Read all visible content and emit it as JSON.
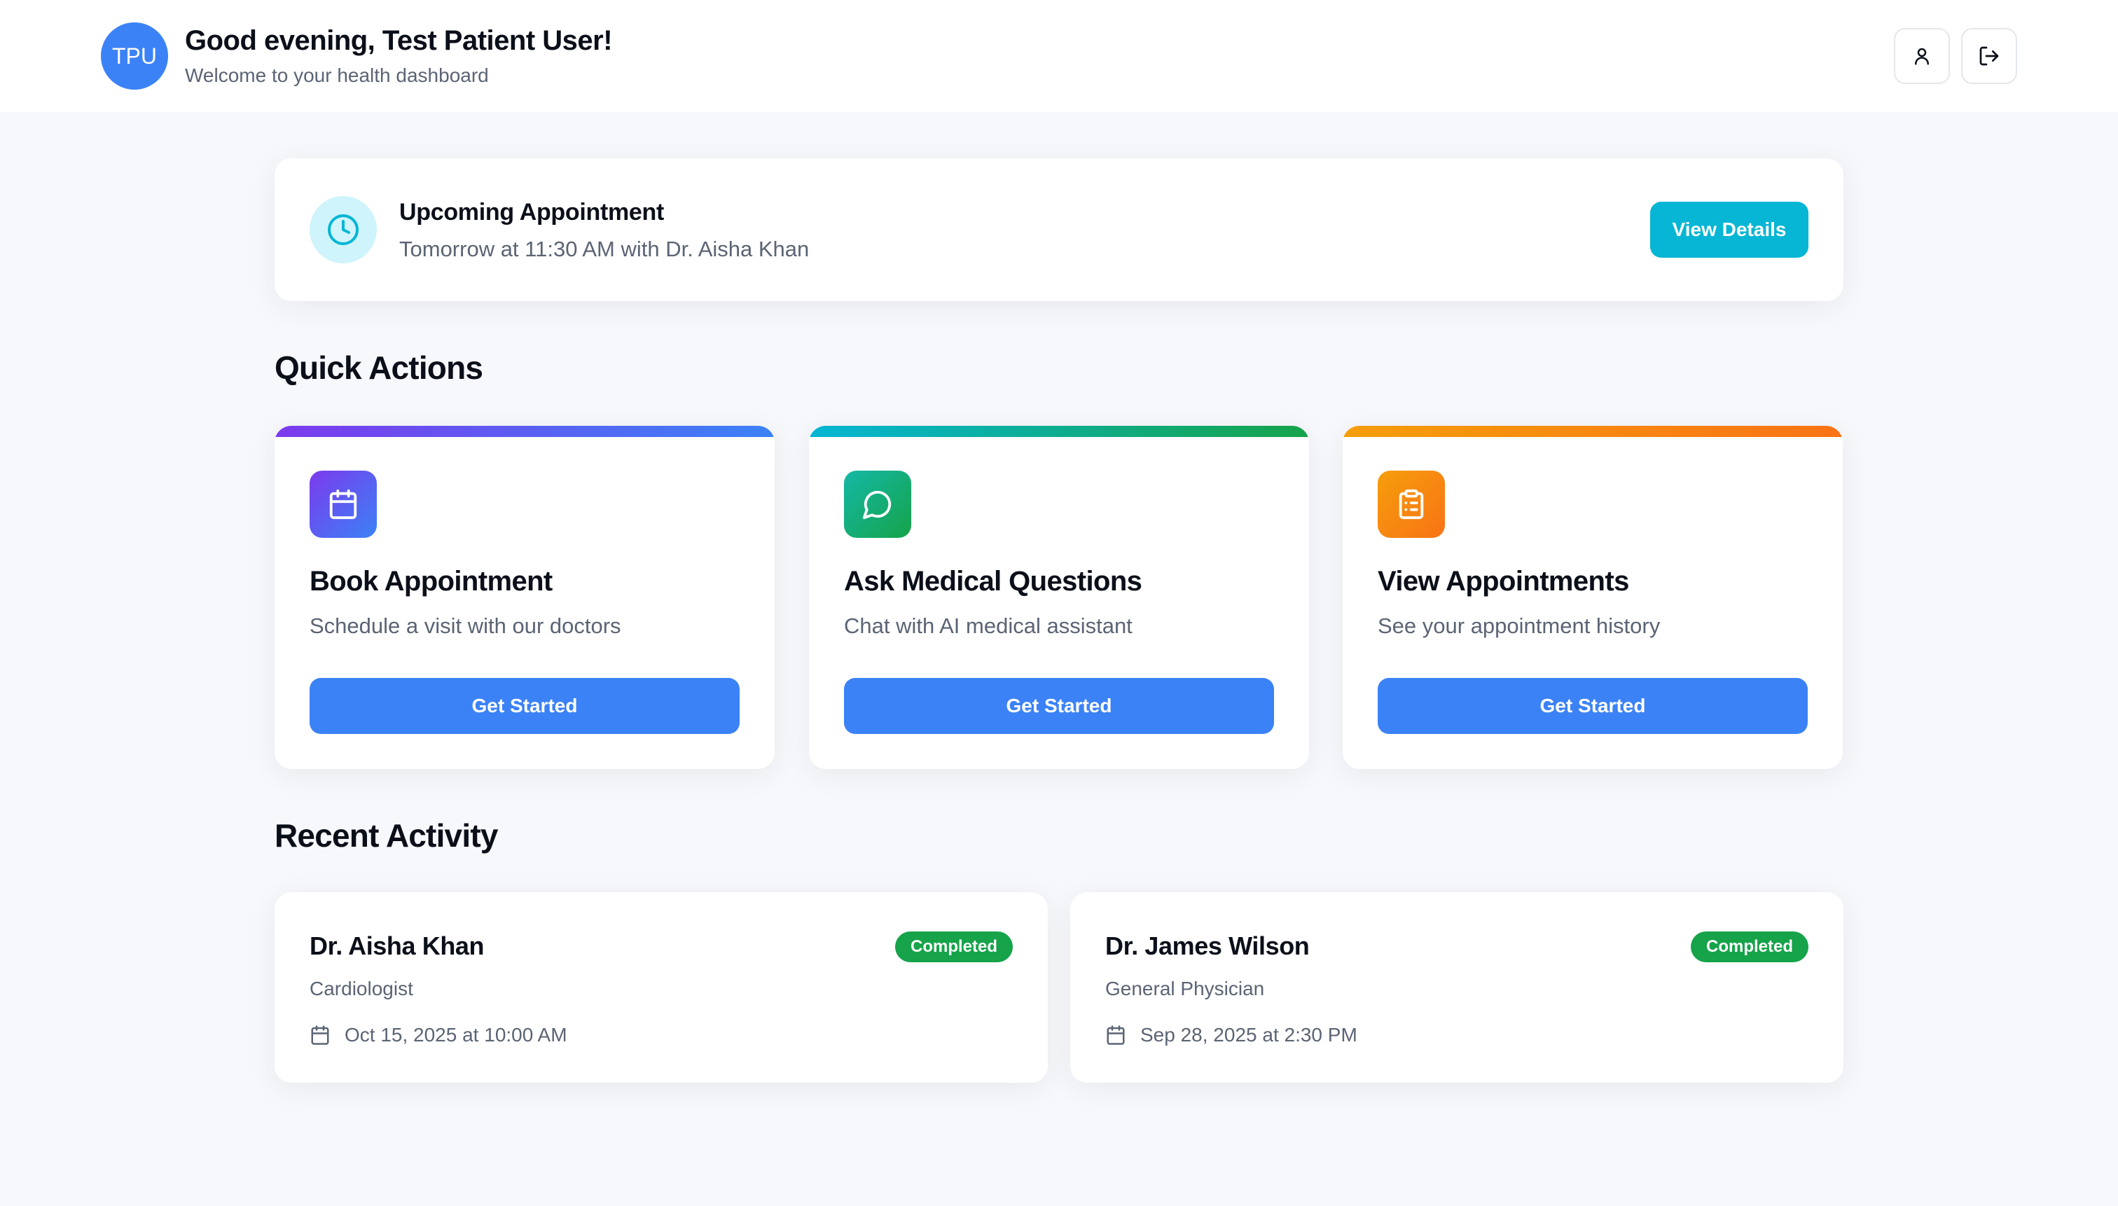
{
  "header": {
    "avatar_initials": "TPU",
    "greeting": "Good evening, Test Patient User!",
    "subtitle": "Welcome to your health dashboard",
    "profile_icon": "user-icon",
    "logout_icon": "logout-icon"
  },
  "upcoming": {
    "icon": "clock-icon",
    "title": "Upcoming Appointment",
    "detail": "Tomorrow at 11:30 AM with Dr. Aisha Khan",
    "button_label": "View Details"
  },
  "quick_actions": {
    "title": "Quick Actions",
    "cards": [
      {
        "icon": "calendar-icon",
        "title": "Book Appointment",
        "description": "Schedule a visit with our doctors",
        "button_label": "Get Started"
      },
      {
        "icon": "chat-bubble-icon",
        "title": "Ask Medical Questions",
        "description": "Chat with AI medical assistant",
        "button_label": "Get Started"
      },
      {
        "icon": "clipboard-list-icon",
        "title": "View Appointments",
        "description": "See your appointment history",
        "button_label": "Get Started"
      }
    ]
  },
  "recent_activity": {
    "title": "Recent Activity",
    "items": [
      {
        "doctor": "Dr. Aisha Khan",
        "specialty": "Cardiologist",
        "status": "Completed",
        "date": "Oct 15, 2025 at 10:00 AM"
      },
      {
        "doctor": "Dr. James Wilson",
        "specialty": "General Physician",
        "status": "Completed",
        "date": "Sep 28, 2025 at 2:30 PM"
      }
    ]
  },
  "colors": {
    "primary": "#3b82f6",
    "accent_cyan": "#06b6d4",
    "success": "#16a34a",
    "muted_text": "#5b6474"
  }
}
